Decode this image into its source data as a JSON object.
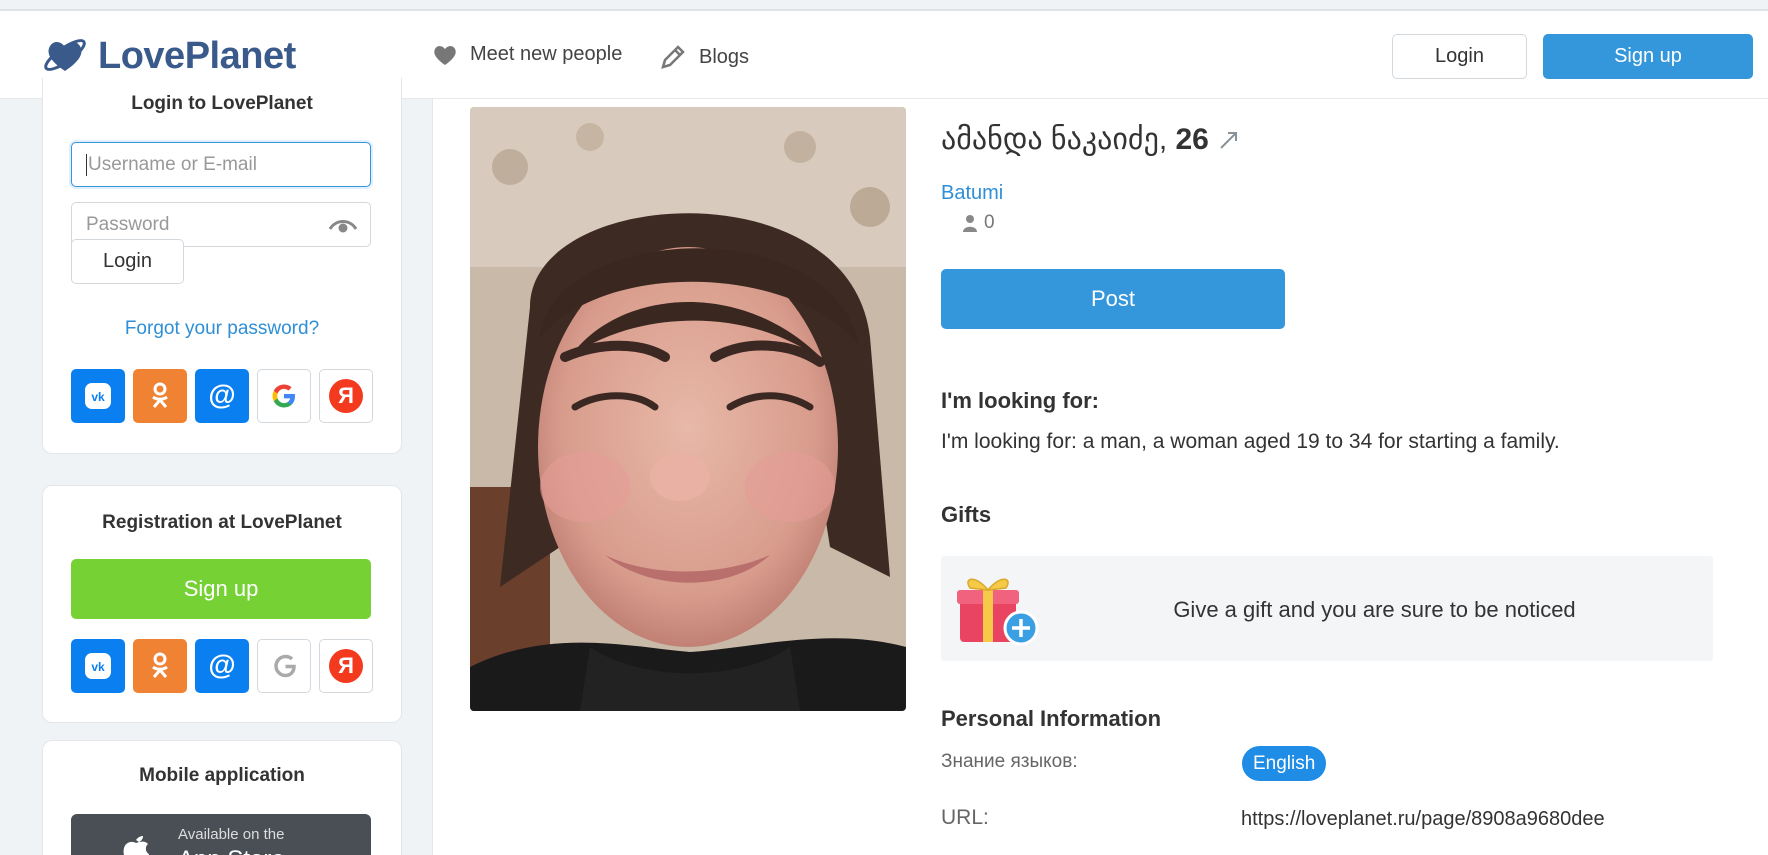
{
  "header": {
    "logo": "LovePlanet",
    "nav": [
      {
        "label": "Meet new people",
        "icon": "heart-icon"
      },
      {
        "label": "Blogs",
        "icon": "pencil-icon"
      }
    ],
    "login_label": "Login",
    "signup_label": "Sign up"
  },
  "sidebar": {
    "login_card": {
      "title": "Login to LovePlanet",
      "username_placeholder": "Username or E-mail",
      "password_placeholder": "Password",
      "login_button": "Login",
      "forgot_link": "Forgot your password?"
    },
    "registration_card": {
      "title": "Registration at LovePlanet",
      "signup_button": "Sign up"
    },
    "mobile_card": {
      "title": "Mobile application",
      "appstore_small": "Available on the",
      "appstore_big": "App Store"
    },
    "social_icons": [
      "vk-icon",
      "odnoklassniki-icon",
      "mail-ru-icon",
      "google-icon",
      "yandex-icon"
    ]
  },
  "profile": {
    "name": "ამანდა ნაკაიძე",
    "age": "26",
    "age_separator": ",",
    "city": "Batumi",
    "friends_count": "0",
    "post_button": "Post",
    "looking_for_heading": "I'm looking for:",
    "looking_for_text": "I'm looking for: a man, a woman aged 19 to 34 for starting a family.",
    "gifts_heading": "Gifts",
    "gifts_text": "Give a gift and you are sure to be noticed",
    "personal_heading": "Personal Information",
    "languages_label": "Знание языков:",
    "languages_value": "English",
    "url_label": "URL:",
    "url_value": "https://loveplanet.ru/page/8908a9680dee"
  },
  "colors": {
    "brand_blue": "#3496db",
    "link_blue": "#2e8fd6",
    "green": "#76d234",
    "logo": "#3a5a8c"
  }
}
